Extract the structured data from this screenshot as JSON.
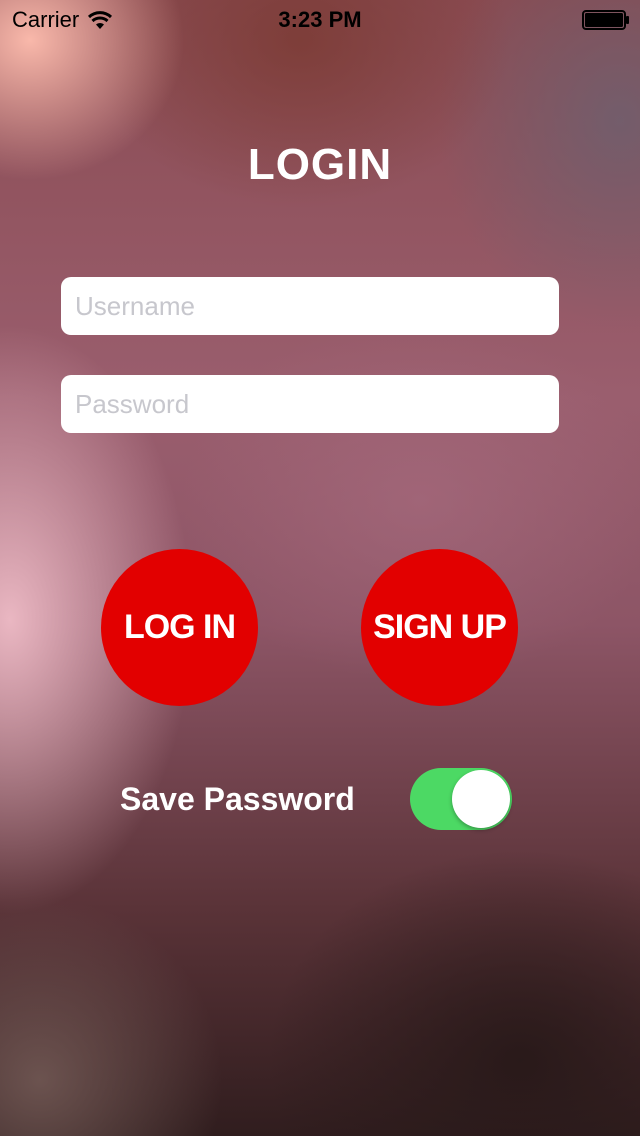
{
  "status_bar": {
    "carrier": "Carrier",
    "time": "3:23 PM"
  },
  "title": "LOGIN",
  "form": {
    "username_placeholder": "Username",
    "password_placeholder": "Password"
  },
  "buttons": {
    "login_label": "LOG IN",
    "signup_label": "SIGN UP"
  },
  "save_password": {
    "label": "Save Password",
    "enabled": true
  },
  "colors": {
    "button_red": "#e20000",
    "toggle_on": "#4cd964"
  }
}
